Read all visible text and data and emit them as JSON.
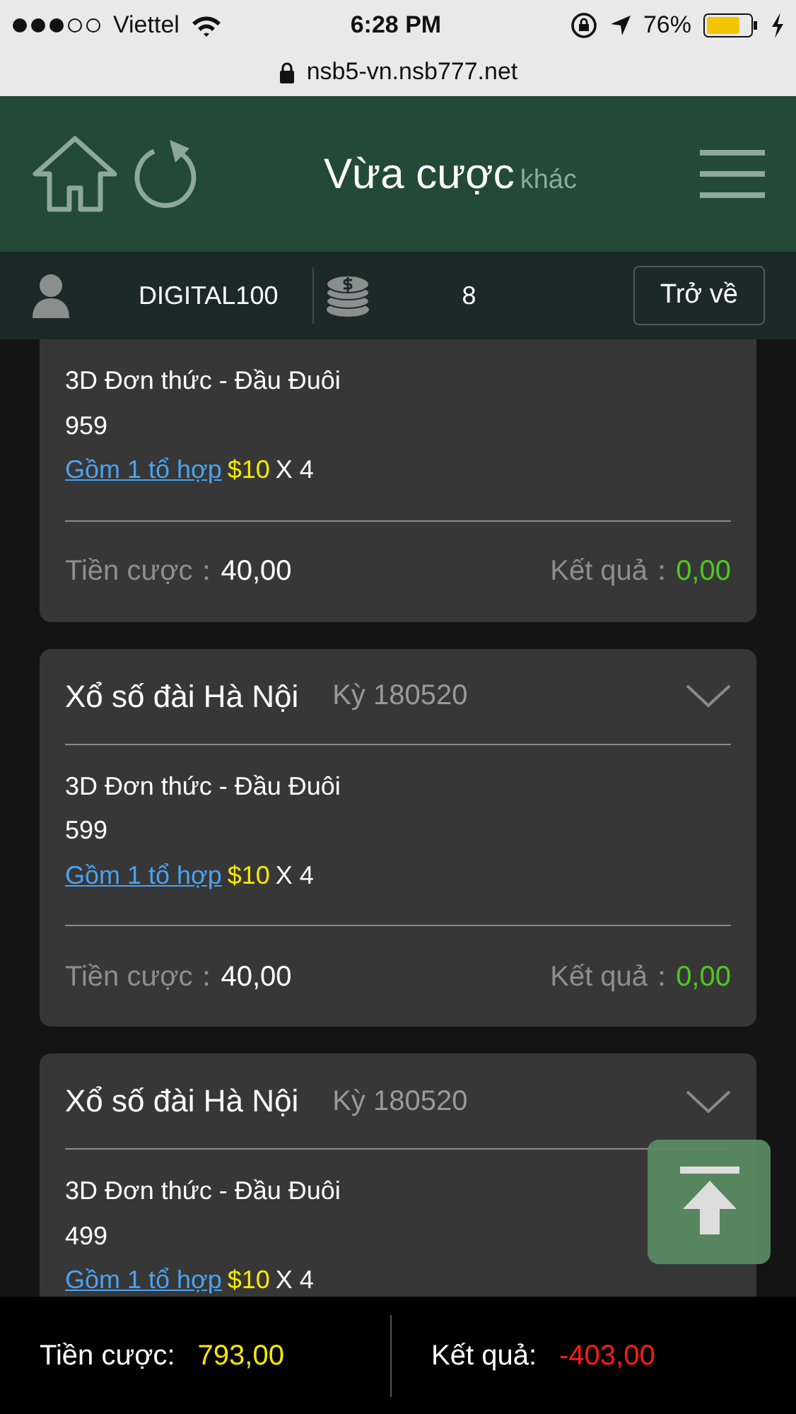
{
  "status_bar": {
    "carrier": "Viettel",
    "time": "6:28 PM",
    "battery": "76%"
  },
  "address_bar": {
    "url": "nsb5-vn.nsb777.net"
  },
  "header": {
    "title": "Vừa cược",
    "subtitle": "khác"
  },
  "user_bar": {
    "username": "DIGITAL100",
    "balance": "8",
    "back_button": "Trở về"
  },
  "bets": [
    {
      "bet_type": "3D Đơn thức - Đầu Đuôi",
      "number": "959",
      "combo_link": "Gồm 1 tổ hợp",
      "price": "$10",
      "multiplier": "X 4",
      "stake_label": "Tiền cược：",
      "stake": "40,00",
      "result_label": "Kết quả：",
      "result": "0,00"
    },
    {
      "lottery": "Xổ số đài Hà Nội",
      "period": "Kỳ 180520",
      "bet_type": "3D Đơn thức - Đầu Đuôi",
      "number": "599",
      "combo_link": "Gồm 1 tổ hợp",
      "price": "$10",
      "multiplier": "X 4",
      "stake_label": "Tiền cược：",
      "stake": "40,00",
      "result_label": "Kết quả：",
      "result": "0,00"
    },
    {
      "lottery": "Xổ số đài Hà Nội",
      "period": "Kỳ 180520",
      "bet_type": "3D Đơn thức - Đầu Đuôi",
      "number": "499",
      "combo_link": "Gồm 1 tổ hợp",
      "price": "$10",
      "multiplier": "X 4"
    }
  ],
  "summary": {
    "stake_label": "Tiền cược:",
    "stake": "793,00",
    "result_label": "Kết quả:",
    "result": "-403,00"
  }
}
